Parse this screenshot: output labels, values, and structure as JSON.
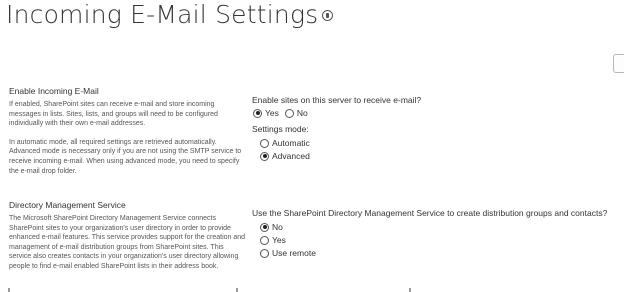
{
  "page": {
    "title": "Incoming E-Mail Settings"
  },
  "incoming_email": {
    "heading": "Enable Incoming E-Mail",
    "description_1": "If enabled, SharePoint sites can receive e-mail and store incoming messages in lists. Sites, lists, and groups will need to be configured individually with their own e-mail addresses.",
    "description_2": "In automatic mode, all required settings are retrieved automatically. Advanced mode is necessary only if you are not using the SMTP service to receive incoming e-mail. When using advanced mode, you need to specify the e-mail drop folder.",
    "enable_question": "Enable sites on this server to receive e-mail?",
    "enable_options": [
      {
        "label": "Yes",
        "checked": true
      },
      {
        "label": "No",
        "checked": false
      }
    ],
    "mode_label": "Settings mode:",
    "mode_options": [
      {
        "label": "Automatic",
        "checked": false
      },
      {
        "label": "Advanced",
        "checked": true
      }
    ]
  },
  "directory_service": {
    "heading": "Directory Management Service",
    "description": "The Microsoft SharePoint Directory Management Service connects SharePoint sites to your organization's user directory in order to provide enhanced e-mail features. This service provides support for the creation and management of e-mail distribution groups from SharePoint sites. This service also creates contacts in your organization's user directory allowing people to find e-mail enabled SharePoint lists in their address book.",
    "question": "Use the SharePoint Directory Management Service to create distribution groups and contacts?",
    "options": [
      {
        "label": "No",
        "checked": true
      },
      {
        "label": "Yes",
        "checked": false
      },
      {
        "label": "Use remote",
        "checked": false
      }
    ]
  }
}
